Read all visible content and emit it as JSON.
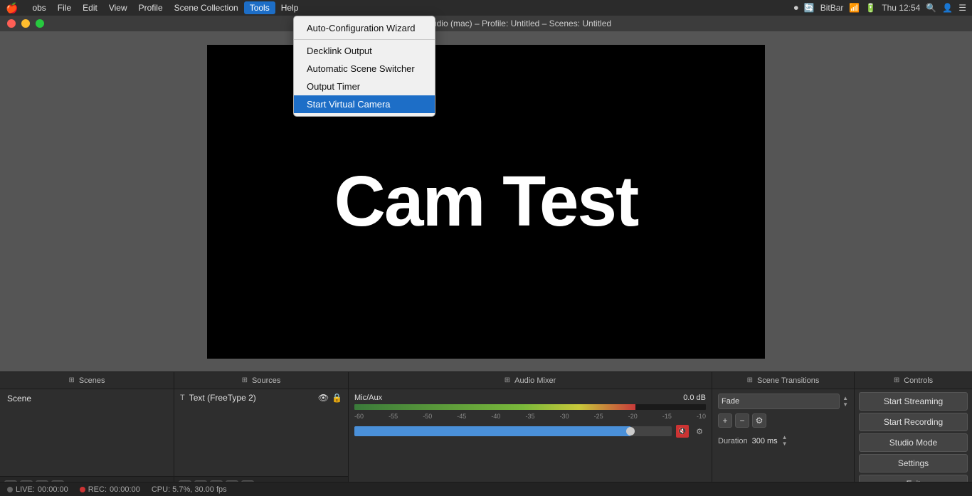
{
  "menubar": {
    "apple": "🍎",
    "items": [
      {
        "id": "obs",
        "label": "obs"
      },
      {
        "id": "file",
        "label": "File"
      },
      {
        "id": "edit",
        "label": "Edit"
      },
      {
        "id": "view",
        "label": "View"
      },
      {
        "id": "profile",
        "label": "Profile"
      },
      {
        "id": "scene-collection",
        "label": "Scene Collection"
      },
      {
        "id": "tools",
        "label": "Tools",
        "active": true
      },
      {
        "id": "help",
        "label": "Help"
      }
    ],
    "right": {
      "bitbar": "BitBar",
      "wifi": "📶",
      "battery": "🔋",
      "time": "Thu 12:54",
      "search": "🔍",
      "avatar": "👤",
      "menu": "☰"
    }
  },
  "titlebar": {
    "title": "OBS Studio (mac) – Profile: Untitled – Scenes: Untitled"
  },
  "tools_dropdown": {
    "items": [
      {
        "id": "auto-config",
        "label": "Auto-Configuration Wizard",
        "selected": false
      },
      {
        "id": "separator1",
        "type": "separator"
      },
      {
        "id": "decklink",
        "label": "Decklink Output",
        "selected": false
      },
      {
        "id": "auto-scene",
        "label": "Automatic Scene Switcher",
        "selected": false
      },
      {
        "id": "output-timer",
        "label": "Output Timer",
        "selected": false
      },
      {
        "id": "virtual-camera",
        "label": "Start Virtual Camera",
        "selected": true
      }
    ]
  },
  "preview": {
    "cam_test_text": "Cam Test"
  },
  "panels": {
    "scenes": {
      "header": "Scenes",
      "items": [
        {
          "label": "Scene"
        }
      ],
      "footer": {
        "add": "+",
        "remove": "−",
        "move_up": "▲",
        "move_down": "▼"
      }
    },
    "sources": {
      "header": "Sources",
      "items": [
        {
          "icon": "T",
          "label": "Text (FreeType 2)",
          "visible": true,
          "locked": false
        }
      ],
      "footer": {
        "add": "+",
        "remove": "−",
        "settings": "⚙",
        "move_up": "▲",
        "move_down": "▼"
      }
    },
    "audio_mixer": {
      "header": "Audio Mixer",
      "tracks": [
        {
          "name": "Mic/Aux",
          "db": "0.0 dB",
          "scale_labels": [
            "-60",
            "-55",
            "-50",
            "-45",
            "-40",
            "-35",
            "-30",
            "-25",
            "-20",
            "-15",
            "-10",
            ""
          ],
          "volume_pct": 87
        }
      ]
    },
    "scene_transitions": {
      "header": "Scene Transitions",
      "transition": "Fade",
      "duration_label": "Duration",
      "duration_value": "300 ms"
    },
    "controls": {
      "header": "Controls",
      "buttons": [
        {
          "id": "start-streaming",
          "label": "Start Streaming"
        },
        {
          "id": "start-recording",
          "label": "Start Recording"
        },
        {
          "id": "studio-mode",
          "label": "Studio Mode"
        },
        {
          "id": "settings",
          "label": "Settings"
        },
        {
          "id": "exit",
          "label": "Exit"
        }
      ]
    }
  },
  "statusbar": {
    "live_label": "LIVE:",
    "live_time": "00:00:00",
    "rec_label": "REC:",
    "rec_time": "00:00:00",
    "cpu": "CPU: 5.7%, 30.00 fps"
  }
}
